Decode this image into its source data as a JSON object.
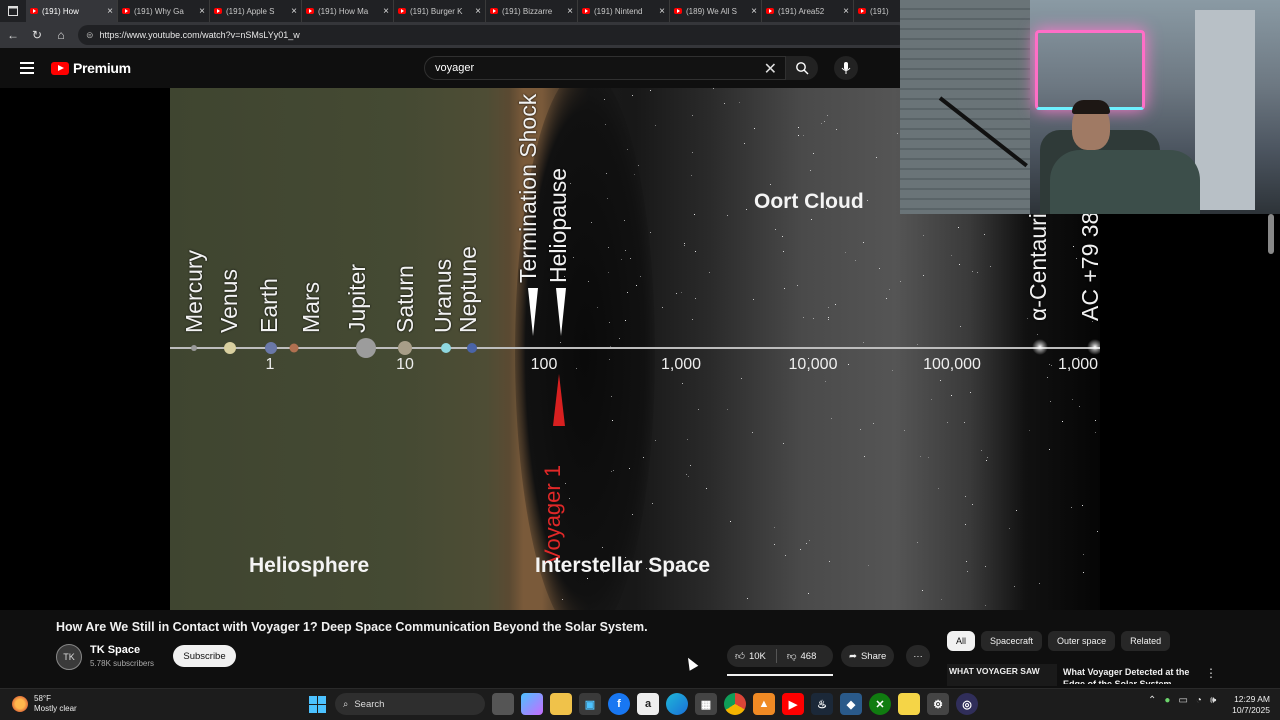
{
  "browser": {
    "tabs": [
      {
        "label": "(191) How",
        "active": true
      },
      {
        "label": "(191) Why Ga",
        "active": false
      },
      {
        "label": "(191) Apple S",
        "active": false
      },
      {
        "label": "(191) How Ma",
        "active": false
      },
      {
        "label": "(191) Burger K",
        "active": false
      },
      {
        "label": "(191) Bizzarre",
        "active": false
      },
      {
        "label": "(191) Nintend",
        "active": false
      },
      {
        "label": "(189) We All S",
        "active": false
      },
      {
        "label": "(191) Area52",
        "active": false
      },
      {
        "label": "(191)",
        "active": false
      }
    ],
    "url": "https://www.youtube.com/watch?v=nSMsLYy01_w"
  },
  "youtube": {
    "logo_text": "Premium",
    "search_value": "voyager",
    "icons": {
      "menu": "menu-icon",
      "clear": "close-icon",
      "search": "search-icon",
      "mic": "mic-icon"
    }
  },
  "video": {
    "planets": [
      "Mercury",
      "Venus",
      "Earth",
      "Mars",
      "Jupiter",
      "Saturn",
      "Uranus",
      "Neptune"
    ],
    "boundaries": [
      "Termination Shock",
      "Heliopause"
    ],
    "far_objects": [
      "α-Centauri",
      "AC +79 38"
    ],
    "ticks": [
      "1",
      "10",
      "100",
      "1,000",
      "10,000",
      "100,000",
      "1,000"
    ],
    "regions": {
      "heliosphere": "Heliosphere",
      "interstellar": "Interstellar Space",
      "oort": "Oort Cloud"
    },
    "probe": "Voyager 1"
  },
  "meta": {
    "title": "How Are We Still in Contact with Voyager 1? Deep Space Communication Beyond the Solar System.",
    "channel_initials": "TK",
    "channel": "TK Space",
    "subscribers": "5.78K subscribers",
    "subscribe": "Subscribe",
    "likes": "10K",
    "dislikes": "468",
    "share": "Share",
    "more": "···"
  },
  "sidebar": {
    "chips": [
      {
        "label": "All",
        "selected": true
      },
      {
        "label": "Spacecraft",
        "selected": false
      },
      {
        "label": "Outer space",
        "selected": false
      },
      {
        "label": "Related",
        "selected": false
      }
    ],
    "rec_thumb_text": "WHAT VOYAGER SAW",
    "rec_title": "What Voyager Detected at the Edge of the Solar System"
  },
  "taskbar": {
    "temp": "58°F",
    "weather": "Mostly clear",
    "search": "Search",
    "time": "12:29 AM",
    "date": "10/7/2025"
  },
  "colors": {
    "youtube_red": "#ff0000",
    "voyager_red": "#d82020",
    "accent_blue": "#4cc2ff"
  }
}
